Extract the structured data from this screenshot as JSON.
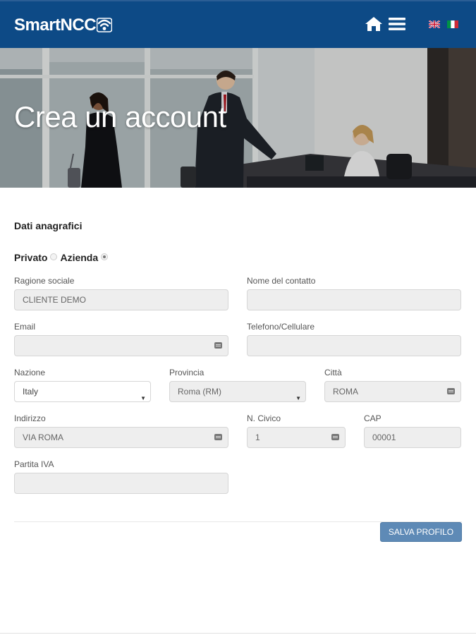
{
  "header": {
    "logo_text_a": "Smart",
    "logo_text_b": "NCC",
    "brand_color": "#0d4a86",
    "icons": [
      "home-icon",
      "menu-icon",
      "flag-uk-icon",
      "flag-it-icon"
    ]
  },
  "hero": {
    "title": "Crea un account"
  },
  "form": {
    "section_title": "Dati anagrafici",
    "type_options": [
      {
        "label": "Privato",
        "selected": false
      },
      {
        "label": "Azienda",
        "selected": true
      }
    ],
    "fields": {
      "ragione_sociale": {
        "label": "Ragione sociale",
        "value": "CLIENTE DEMO"
      },
      "nome_contatto": {
        "label": "Nome del contatto",
        "value": ""
      },
      "email": {
        "label": "Email",
        "value": ""
      },
      "telefono": {
        "label": "Telefono/Cellulare",
        "value": ""
      },
      "nazione": {
        "label": "Nazione",
        "value": "Italy"
      },
      "provincia": {
        "label": "Provincia",
        "value": "Roma (RM)"
      },
      "citta": {
        "label": "Città",
        "value": "ROMA"
      },
      "indirizzo": {
        "label": "Indirizzo",
        "value": "VIA ROMA"
      },
      "civico": {
        "label": "N. Civico",
        "value": "1"
      },
      "cap": {
        "label": "CAP",
        "value": "00001"
      },
      "partita_iva": {
        "label": "Partita IVA",
        "value": ""
      }
    },
    "save_label": "SALVA PROFILO",
    "save_color": "#5e8ab6"
  }
}
